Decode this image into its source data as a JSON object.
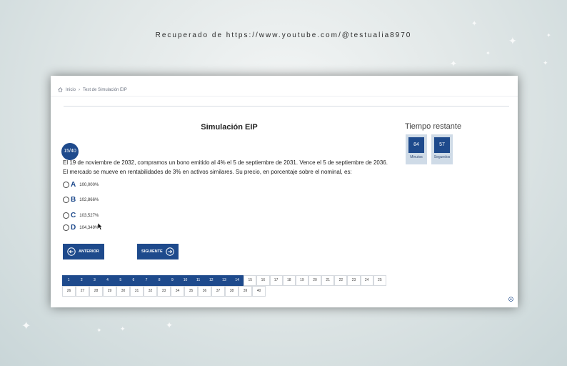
{
  "caption": "Recuperado de https://www.youtube.com/@testualia8970",
  "breadcrumb": {
    "home": "Inicio",
    "separator": "›",
    "current": "Test de Simulación EIP"
  },
  "title": "Simulación EIP",
  "timer": {
    "heading": "Tiempo restante",
    "minutes_value": "84",
    "minutes_label": "Minutos",
    "seconds_value": "57",
    "seconds_label": "Segundos"
  },
  "question": {
    "badge": "15/40",
    "text": "El 19 de noviembre de 2032, compramos un bono emitido al 4% el 5 de septiembre de 2031. Vence el 5 de septiembre de 2036. El mercado se mueve en rentabilidades de 3% en activos similares. Su precio, en porcentaje sobre el nominal, es:",
    "options": [
      {
        "letter": "A",
        "text": "100,000%"
      },
      {
        "letter": "B",
        "text": "102,866%"
      },
      {
        "letter": "C",
        "text": "103,527%"
      },
      {
        "letter": "D",
        "text": "104,349%"
      }
    ]
  },
  "nav": {
    "prev_label": "ANTERIOR",
    "next_label": "SIGUIENTE"
  },
  "pager": {
    "row1": [
      "1",
      "2",
      "3",
      "4",
      "5",
      "6",
      "7",
      "8",
      "9",
      "10",
      "11",
      "12",
      "13",
      "14",
      "15",
      "16",
      "17",
      "18",
      "19",
      "20",
      "21",
      "22",
      "23",
      "24",
      "25"
    ],
    "row2": [
      "26",
      "27",
      "28",
      "29",
      "30",
      "31",
      "32",
      "33",
      "34",
      "35",
      "36",
      "37",
      "38",
      "39",
      "40"
    ],
    "answered_through": 14,
    "current": 15
  },
  "colors": {
    "accent": "#1e4a8c",
    "timer_bg": "#cfdbe7"
  }
}
